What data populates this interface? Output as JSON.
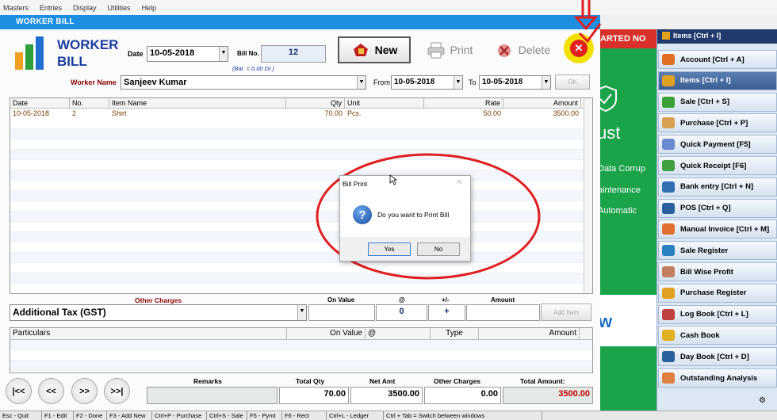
{
  "menu": [
    "Masters",
    "Entries",
    "Display",
    "Utilities",
    "Help"
  ],
  "window_title": "WORKER BILL",
  "logo_text_1": "WORKER",
  "logo_text_2": "BILL",
  "date_label": "Date",
  "date_value": "10-05-2018",
  "billno_label": "Bill No.",
  "billno_value": "12",
  "balance_text": "(Bal. = 0.00 Dr.)",
  "buttons": {
    "new": "New",
    "print": "Print",
    "delete": "Delete",
    "ok": "OK",
    "add_item": "Add Item"
  },
  "worker_label": "Worker Name",
  "worker_value": "Sanjeev Kumar",
  "from_label": "From",
  "from_value": "10-05-2018",
  "to_label": "To",
  "to_value": "10-05-2018",
  "items_grid": {
    "headers": [
      "Date",
      "No.",
      "Item Name",
      "Qty",
      "Unit",
      "Rate",
      "Amount"
    ],
    "rows": [
      [
        "10-05-2018",
        "2",
        "Shirt",
        "70.00",
        "Pcs.",
        "50.00",
        "3500.00"
      ]
    ]
  },
  "other_charges_label": "Other Charges",
  "on_value_label": "On Value",
  "at_label": "@",
  "plusminus_label": "+/-",
  "amount_label": "Amount",
  "charge_select": "Additional Tax (GST)",
  "at_value": "0",
  "plus_value": "+",
  "charges_grid": {
    "headers": [
      "Particulars",
      "On Value",
      "@",
      "Type",
      "Amount"
    ]
  },
  "nav": [
    "|<<",
    "<<",
    ">>",
    ">>|"
  ],
  "totals": {
    "remarks_label": "Remarks",
    "total_qty_label": "Total Qty",
    "total_qty": "70.00",
    "net_amt_label": "Net Amt",
    "net_amt": "3500.00",
    "other_charges_label": "Other Charges",
    "other_charges": "0.00",
    "total_amount_label": "Total Amount:",
    "total_amount": "3500.00"
  },
  "status": [
    "Esc - Quit",
    "F1 - Edit",
    "F2 - Done",
    "F3 - Add New",
    "Ctrl+P - Purchase",
    "Ctrl+S - Sale",
    "F5 - Pymt",
    "F6 - Rect",
    "Ctrl+L - Ledger",
    "Ctrl + Tab = Switch between windows"
  ],
  "dialog": {
    "title": "Bill Print",
    "message": "Do you want to Print Bill",
    "yes": "Yes",
    "no": "No"
  },
  "background_text": {
    "banner": "ARTED NO",
    "line1": "ust",
    "line2": "Data Corrup",
    "line3": "aintenance",
    "line4": "Automatic",
    "line5": "w"
  },
  "sidebar": {
    "header": "Items [Ctrl + I]",
    "items": [
      {
        "label": "Account [Ctrl + A]",
        "color": "#e07020"
      },
      {
        "label": "Items [Ctrl + I]",
        "color": "#e0a020",
        "active": true
      },
      {
        "label": "Sale [Ctrl + S]",
        "color": "#3aa035"
      },
      {
        "label": "Purchase [Ctrl + P]",
        "color": "#d8a050"
      },
      {
        "label": "Quick Payment [F5]",
        "color": "#6a8ad0"
      },
      {
        "label": "Quick Receipt [F6]",
        "color": "#40a040"
      },
      {
        "label": "Bank entry [Ctrl + N]",
        "color": "#3070b0"
      },
      {
        "label": "POS [Ctrl + Q]",
        "color": "#2a60a0"
      },
      {
        "label": "Manual Invoice [Ctrl + M]",
        "color": "#e07030"
      },
      {
        "label": "Sale Register",
        "color": "#2a80c0"
      },
      {
        "label": "Bill Wise Profit",
        "color": "#c08060"
      },
      {
        "label": "Purchase Register",
        "color": "#e0a020"
      },
      {
        "label": "Log Book [Ctrl + L]",
        "color": "#c04040"
      },
      {
        "label": "Cash Book",
        "color": "#e0b020"
      },
      {
        "label": "Day Book [Ctrl + D]",
        "color": "#2a60a0"
      },
      {
        "label": "Outstanding Analysis",
        "color": "#e08040"
      }
    ]
  }
}
